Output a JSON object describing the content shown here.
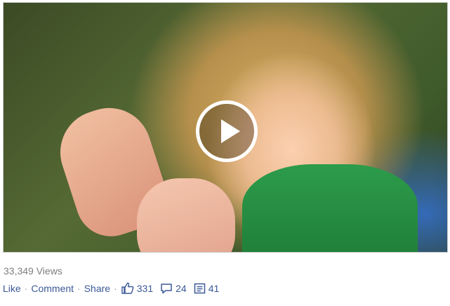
{
  "video": {
    "play_icon": "play-icon"
  },
  "stats_line": {
    "views_text": "33,349 Views"
  },
  "actions": {
    "like_label": "Like",
    "comment_label": "Comment",
    "share_label": "Share",
    "separator": "·",
    "like_count": "331",
    "comment_count": "24",
    "share_count": "41"
  },
  "colors": {
    "link": "#3b5998",
    "muted": "#7f7f7f"
  },
  "icons": {
    "like": "thumbs-up-icon",
    "comment": "comment-bubble-icon",
    "share": "share-icon"
  }
}
